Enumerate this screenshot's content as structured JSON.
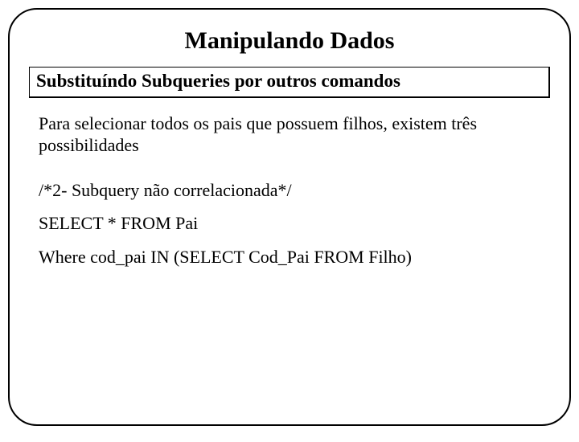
{
  "title": "Manipulando Dados",
  "subtitle": "Substituíndo Subqueries por outros comandos",
  "intro": "Para selecionar todos os pais que possuem filhos, existem três possibilidades",
  "code": {
    "line1": "/*2- Subquery não correlacionada*/",
    "line2": "SELECT * FROM Pai",
    "line3": "Where cod_pai IN (SELECT Cod_Pai FROM Filho)"
  }
}
